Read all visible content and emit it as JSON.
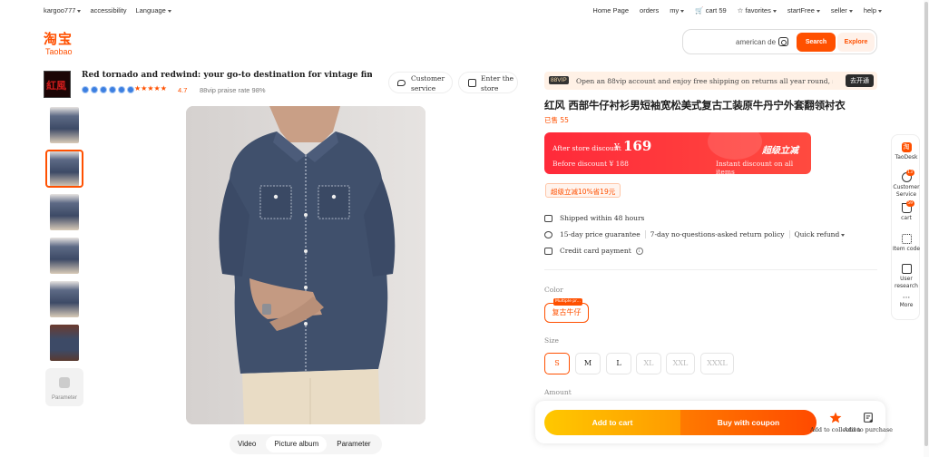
{
  "topbar": {
    "user": "kargoo777",
    "accessibility": "accessibility",
    "language": "Language",
    "home": "Home Page",
    "orders": "orders",
    "my": "my",
    "cart": "cart 59",
    "favorites": "favorites",
    "startfree": "startFree",
    "seller": "seller",
    "help": "help"
  },
  "logo": {
    "cn": "淘宝",
    "en": "Taobao"
  },
  "search": {
    "value": "american de",
    "search_label": "Search",
    "explore_label": "Explore"
  },
  "shop": {
    "name": "Red tornado and redwind: your go-to destination for vintage finds and de...",
    "stars": "★★★★★",
    "rating": "4.7",
    "praise": "88vip praise rate 98%",
    "customer_service": "Customer service",
    "enter_store": "Enter the store"
  },
  "gallery": {
    "param_label": "Parameter",
    "tabs": [
      "Video",
      "Picture album",
      "Parameter"
    ],
    "active_tab": "Picture album"
  },
  "vip": {
    "tag": "88VIP",
    "message": "Open an 88vip account and enjoy free shipping on returns all year round, saving up",
    "cta": "去开通"
  },
  "product": {
    "title": "红风 西部牛仔衬衫男短袖宽松美式复古工装原牛丹宁外套翻领衬衣",
    "sold": "已售 55"
  },
  "price": {
    "after_label": "After store discount",
    "currency": "¥",
    "after_value": "169",
    "highlight": "超级立减",
    "before_label": "Before discount ¥ 188",
    "instant": "Instant discount on all items",
    "coupon": "超级立减10%省19元"
  },
  "services": {
    "shipping": "Shipped within 48 hours",
    "guarantee": "15-day price guarantee",
    "returns": "7-day no-questions-asked return policy",
    "refund": "Quick refund",
    "payment": "Credit card payment"
  },
  "options": {
    "color_label": "Color",
    "color_value": "复古牛仔",
    "color_tag": "Multiple pr...",
    "size_label": "Size",
    "sizes": [
      "S",
      "M",
      "L",
      "XL",
      "XXL",
      "XXXL"
    ],
    "selected_size": "S",
    "amount_label": "Amount"
  },
  "actions": {
    "add_cart": "Add to cart",
    "buy_coupon": "Buy with coupon",
    "collect": "Add to collection",
    "purchase": "Add to purchase"
  },
  "rail": {
    "taodesk": "TaoDesk",
    "customer_service": "Customer Service",
    "cs_badge": "13",
    "cart": "cart",
    "cart_badge": "59",
    "item_code": "Item code",
    "user_research": "User research",
    "more": "More"
  },
  "colors": {
    "accent": "#ff5000",
    "price_red": "#ff2a3a",
    "yellow": "#ffc800"
  }
}
